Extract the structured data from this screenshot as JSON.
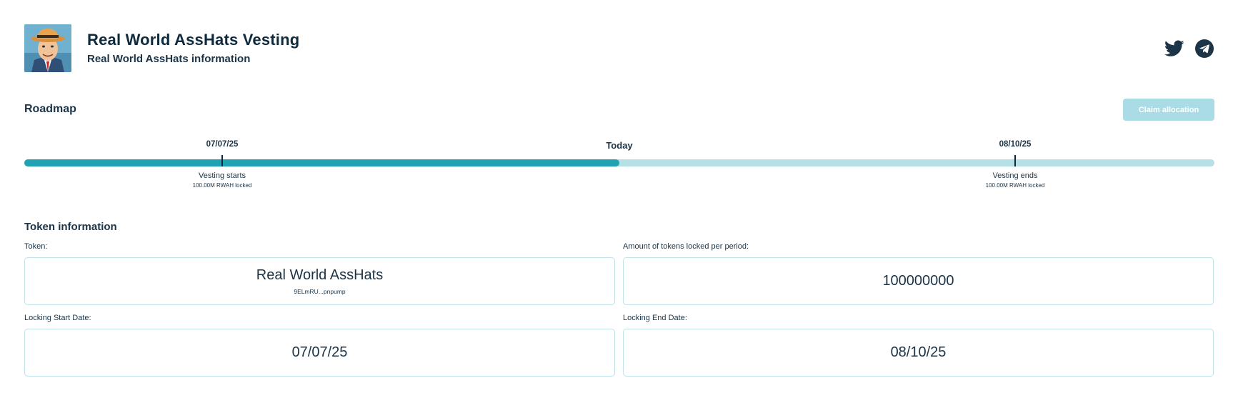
{
  "header": {
    "title": "Real World AssHats Vesting",
    "subtitle": "Real World AssHats information",
    "avatar_icon": "cartoon-man-hat-avatar",
    "socials": [
      {
        "icon": "twitter-icon"
      },
      {
        "icon": "telegram-icon"
      }
    ]
  },
  "roadmap": {
    "title": "Roadmap",
    "claim_label": "Claim allocation",
    "progress": 0.5,
    "start": {
      "date": "07/07/25",
      "label": "Vesting starts",
      "sub": "100.00M RWAH locked"
    },
    "today": {
      "label": "Today"
    },
    "end": {
      "date": "08/10/25",
      "label": "Vesting ends",
      "sub": "100.00M RWAH locked"
    }
  },
  "token_info": {
    "title": "Token information",
    "token": {
      "label": "Token:",
      "value": "Real World AssHats",
      "address": "9ELmRU...pnpump"
    },
    "amount": {
      "label": "Amount of tokens locked per period:",
      "value": "100000000"
    },
    "start_date": {
      "label": "Locking Start Date:",
      "value": "07/07/25"
    },
    "end_date": {
      "label": "Locking End Date:",
      "value": "08/10/25"
    }
  },
  "colors": {
    "accent": "#1fa3b3",
    "track": "#b5e0e6",
    "text": "#0f2a3d",
    "button_disabled": "#a9dce5"
  }
}
